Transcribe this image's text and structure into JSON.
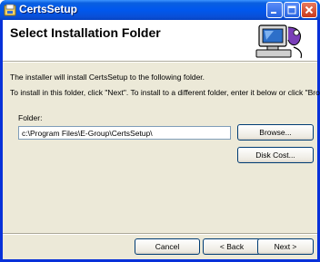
{
  "window": {
    "title": "CertsSetup"
  },
  "banner": {
    "title": "Select Installation Folder"
  },
  "body": {
    "line1": "The installer will install CertsSetup to the following folder.",
    "line2": "To install in this folder, click \"Next\". To install to a different folder, enter it below or click \"Browse\"."
  },
  "folder": {
    "label": "Folder:",
    "value": "c:\\Program Files\\E-Group\\CertsSetup\\"
  },
  "buttons": {
    "browse": "Browse...",
    "disk_cost": "Disk Cost...",
    "cancel": "Cancel",
    "back": "< Back",
    "next": "Next >"
  },
  "colors": {
    "titlebar": "#0058ee",
    "dialog_bg": "#ece9d8",
    "banner_bg": "#ffffff"
  }
}
